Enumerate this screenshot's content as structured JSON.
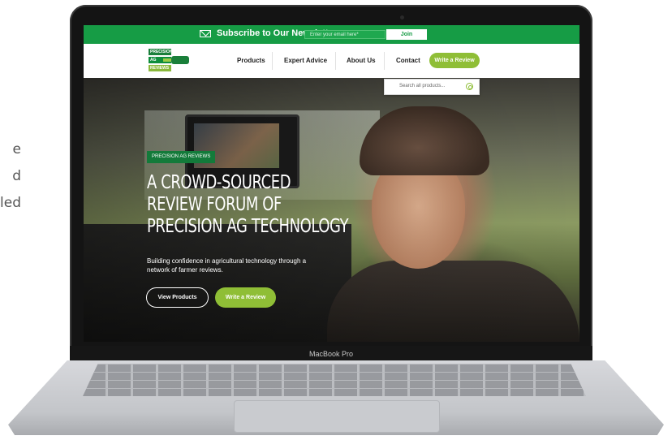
{
  "left_text": [
    "e",
    "d",
    "led"
  ],
  "newsletter": {
    "title": "Subscribe to Our Newsletter",
    "email_placeholder": "Enter your email here*",
    "join_label": "Join"
  },
  "logo": {
    "lines": [
      "PRECISION",
      "AG",
      "REVIEWS"
    ]
  },
  "nav": {
    "items": [
      "Products",
      "Expert Advice",
      "About Us",
      "Contact"
    ],
    "cta_label": "Write a Review"
  },
  "search": {
    "placeholder": "Search all products..."
  },
  "hero": {
    "tag": "PRECISION AG REVIEWS",
    "headline_lines": [
      "A CROWD-SOURCED",
      "REVIEW FORUM OF",
      "PRECISION AG TECHNOLOGY"
    ],
    "subtext": "Building confidence in agricultural technology through a network of farmer reviews.",
    "primary_button": "View Products",
    "secondary_button": "Write a Review"
  },
  "device_label": "MacBook Pro",
  "colors": {
    "brand_green": "#169c45",
    "accent_green": "#8fbe36",
    "dark_green": "#137a3a"
  }
}
